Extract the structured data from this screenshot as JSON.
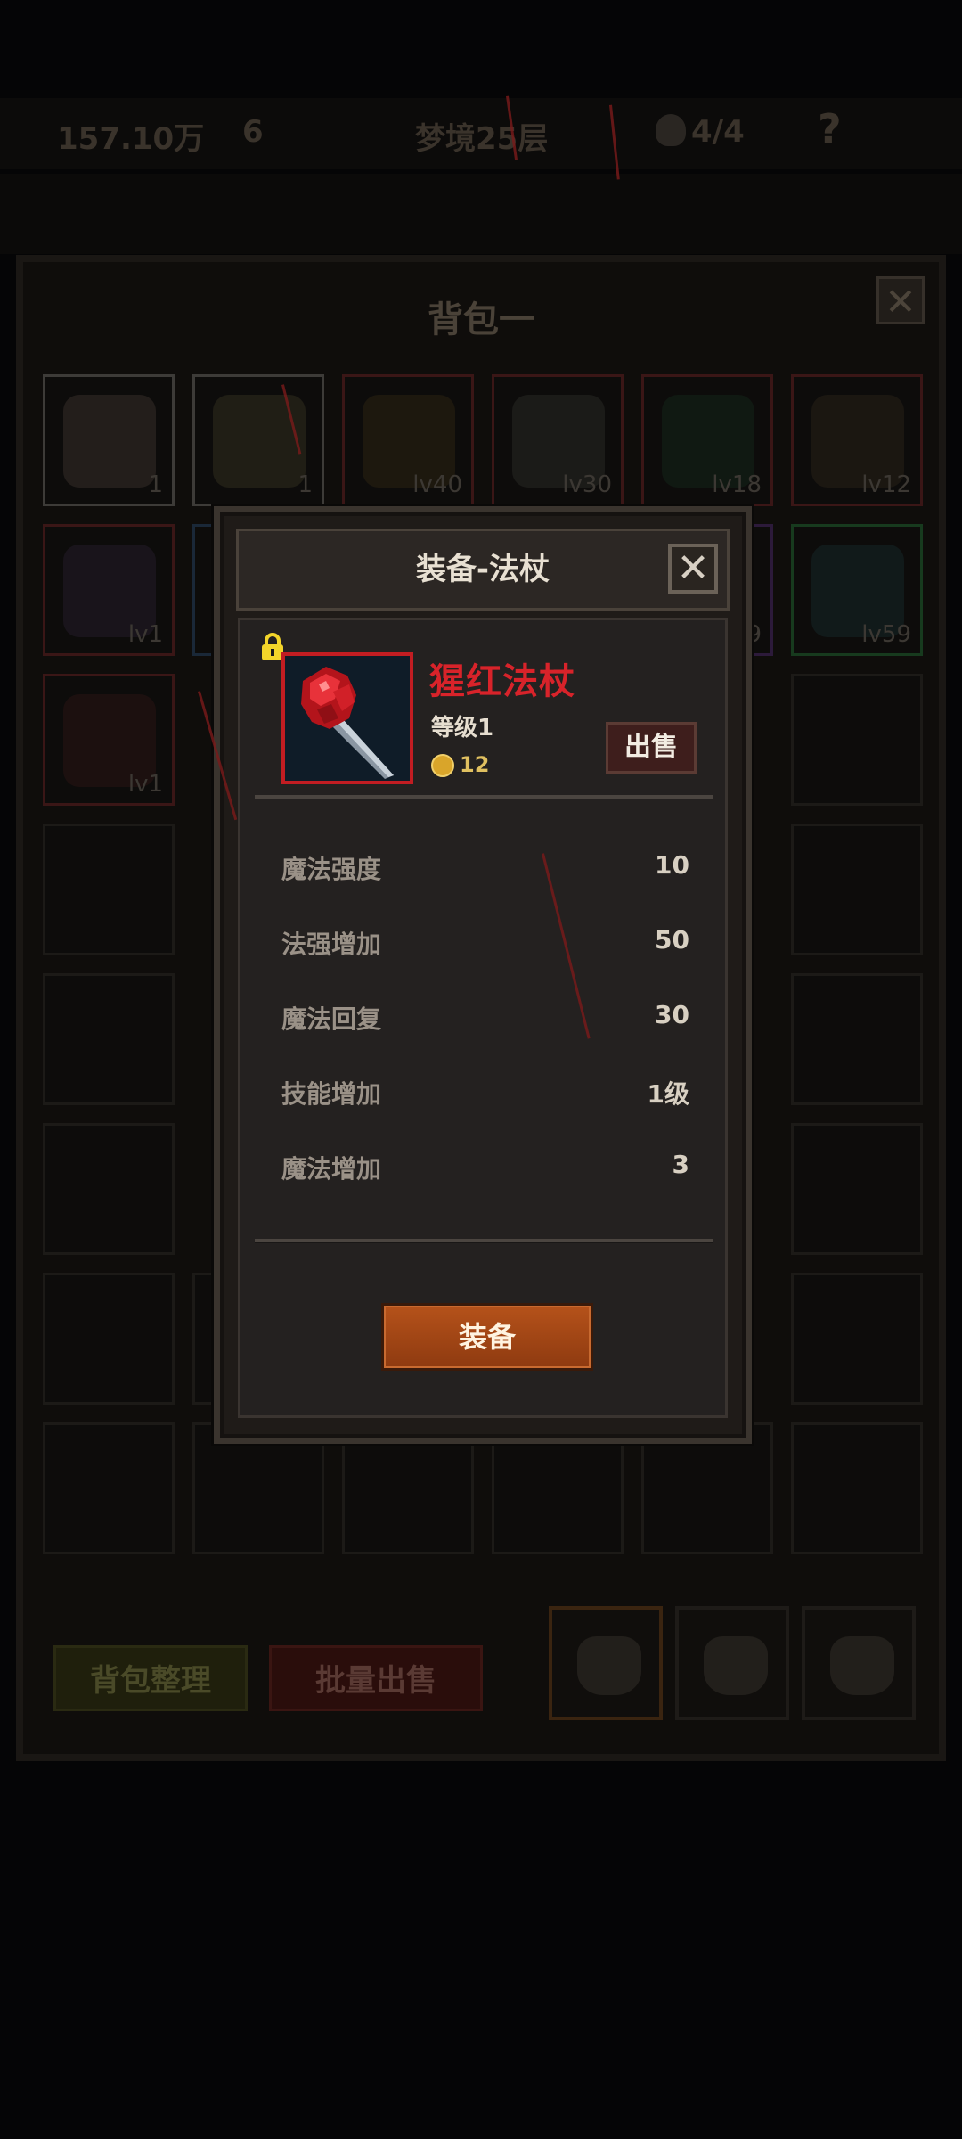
{
  "topbar": {
    "gold": "157.10万",
    "gems": "6",
    "stage": "梦境25层",
    "kills": "4/4",
    "help": "?"
  },
  "bag": {
    "title": "背包一",
    "close": "✕",
    "slot_levels": [
      "1",
      "1",
      "lv40",
      "lv30",
      "lv18",
      "lv12",
      "lv1",
      "",
      "",
      "",
      "9",
      "lv59",
      "lv1"
    ],
    "sort_label": "背包整理",
    "bulk_sell_label": "批量出售"
  },
  "modal": {
    "title": "装备-法杖",
    "close": "✕",
    "item_name": "猩红法杖",
    "item_level": "等级1",
    "price": "12",
    "sell_label": "出售",
    "equip_label": "装备",
    "stats": [
      {
        "label": "魔法强度",
        "value": "10"
      },
      {
        "label": "法强增加",
        "value": "50"
      },
      {
        "label": "魔法回复",
        "value": "30"
      },
      {
        "label": "技能增加",
        "value": "1级"
      },
      {
        "label": "魔法增加",
        "value": "3"
      }
    ]
  },
  "colors": {
    "item_name": "#d8232a",
    "item_border": "#c21d22",
    "equip_button": "#a5471a",
    "sell_button": "#3e1e1c"
  }
}
